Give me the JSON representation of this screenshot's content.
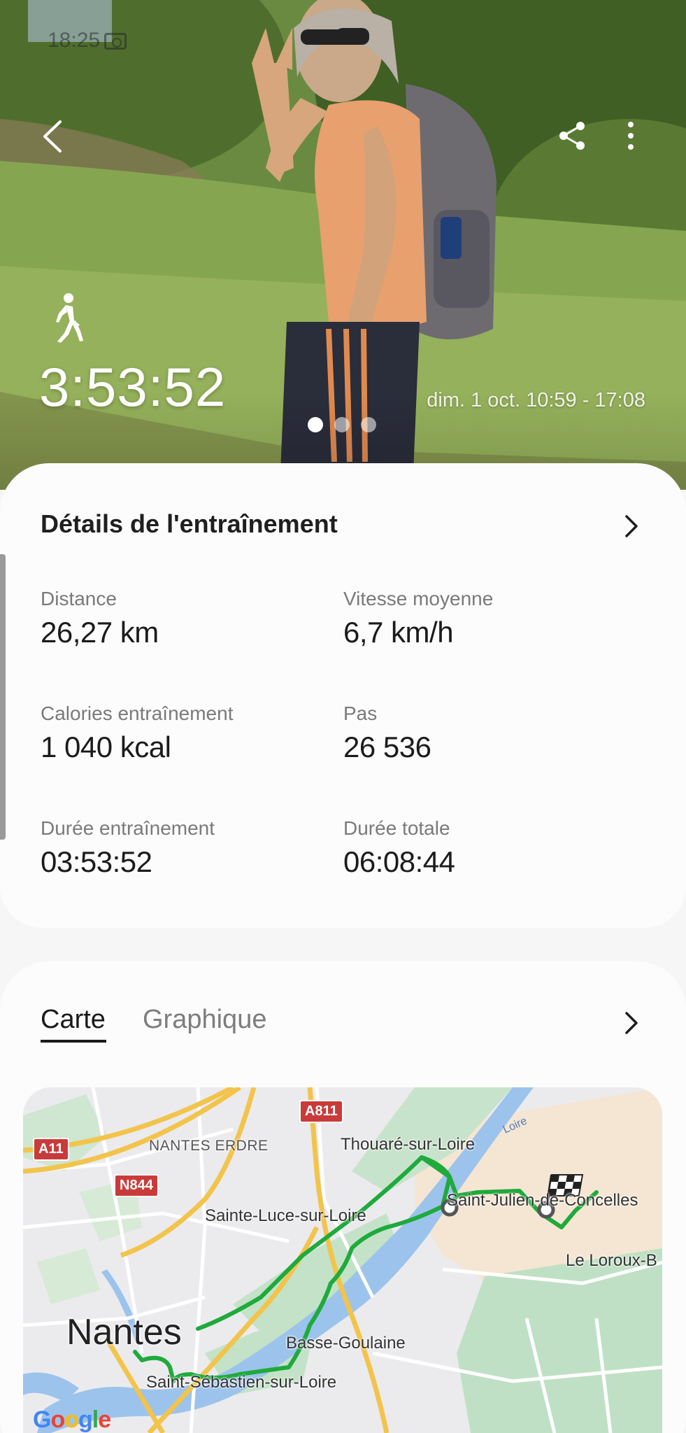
{
  "status_bar": {
    "time": "18:25",
    "right": ""
  },
  "hero": {
    "duration": "3:53:52",
    "date_range": "dim. 1 oct. 10:59 - 17:08",
    "dots_count": 3,
    "active_dot": 0
  },
  "details": {
    "title": "Détails de l'entraînement",
    "stats": [
      {
        "label": "Distance",
        "value": "26,27 km"
      },
      {
        "label": "Vitesse moyenne",
        "value": "6,7 km/h"
      },
      {
        "label": "Calories entraînement",
        "value": "1 040 kcal"
      },
      {
        "label": "Pas",
        "value": "26 536"
      },
      {
        "label": "Durée entraînement",
        "value": "03:53:52"
      },
      {
        "label": "Durée totale",
        "value": "06:08:44"
      }
    ]
  },
  "map_card": {
    "tabs": [
      {
        "label": "Carte",
        "active": true
      },
      {
        "label": "Graphique",
        "active": false
      }
    ],
    "map": {
      "places": [
        "Thouaré-sur-Loire",
        "Sainte-Luce-sur-Loire",
        "Saint-Julien-de-Concelles",
        "Le Loroux-B",
        "Nantes",
        "Basse-Goulaine",
        "Saint-Sébastien-sur-Loire",
        "NANTES ERDRE"
      ],
      "roads": [
        "A811",
        "A11",
        "N844"
      ],
      "river": "Loire",
      "attribution": "Google",
      "route_color": "#1faa3c"
    }
  }
}
